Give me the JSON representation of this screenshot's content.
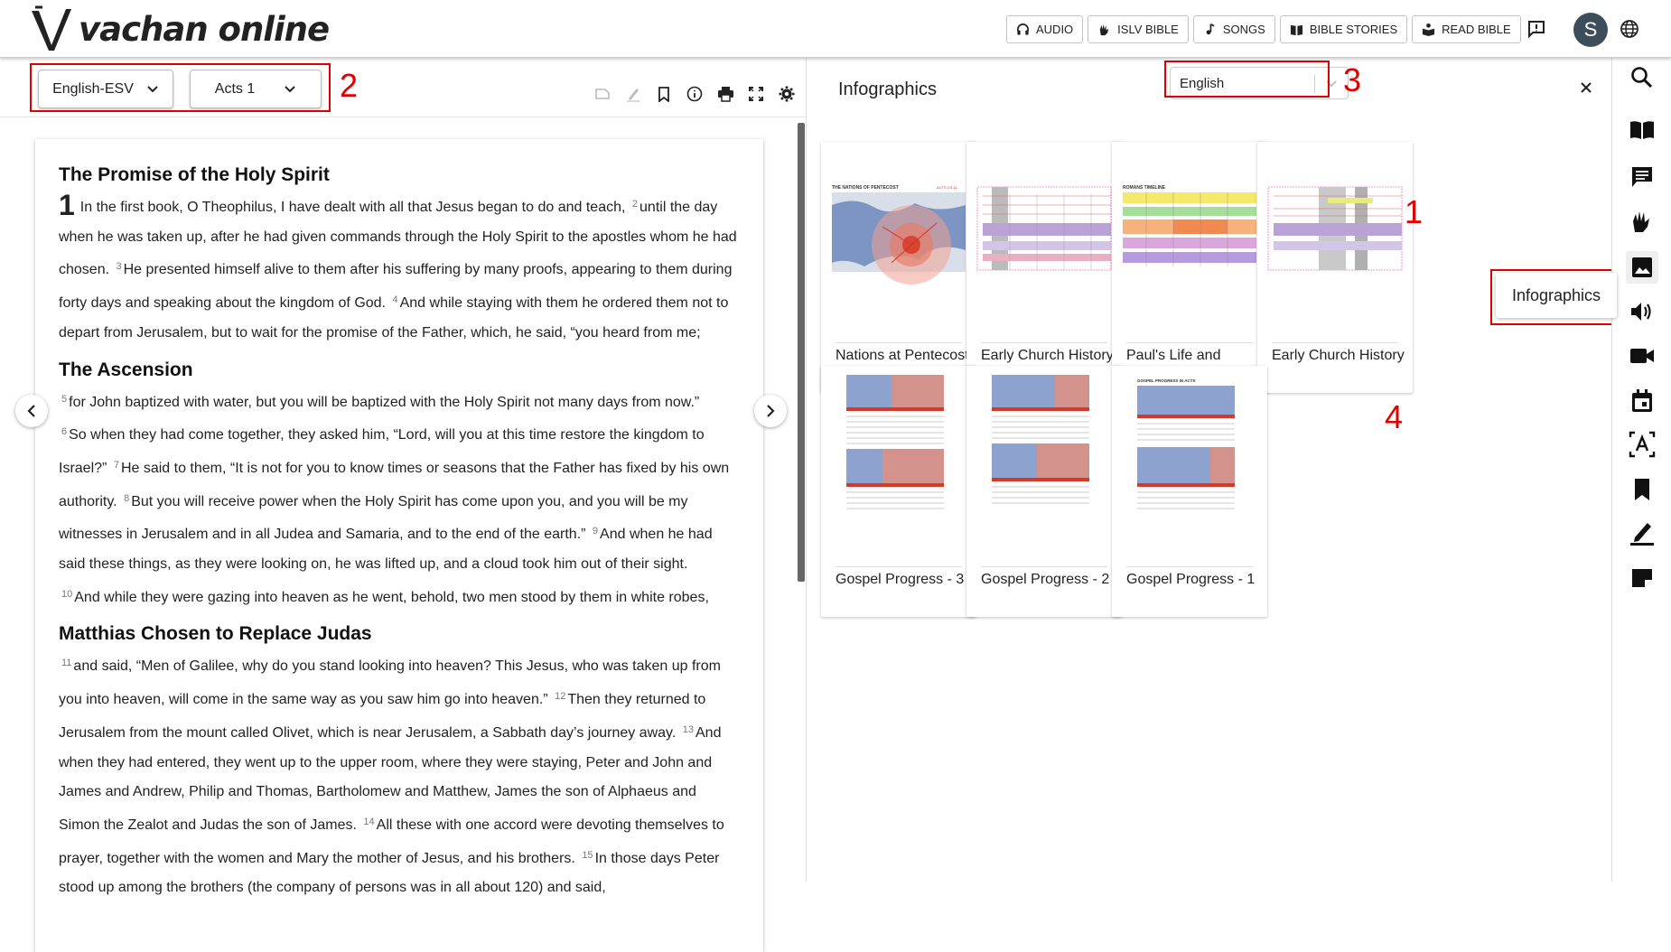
{
  "app": {
    "logo_text": "vachan online"
  },
  "header": {
    "nav": [
      {
        "label": "AUDIO",
        "icon": "headphones-icon"
      },
      {
        "label": "ISLV BIBLE",
        "icon": "sign-language-icon"
      },
      {
        "label": "SONGS",
        "icon": "music-note-icon"
      },
      {
        "label": "BIBLE STORIES",
        "icon": "book-open-icon"
      },
      {
        "label": "READ BIBLE",
        "icon": "book-reader-icon"
      }
    ],
    "avatar_initial": "S"
  },
  "left_toolbar": {
    "version": "English-ESV",
    "book_chapter": "Acts 1"
  },
  "annotations": [
    "1",
    "2",
    "3",
    "4"
  ],
  "reader": {
    "sections": [
      {
        "heading": "The Promise of the Holy Spirit",
        "chapter": "1",
        "verses": [
          {
            "n": "",
            "text": "In the first book, O Theophilus, I have dealt with all that Jesus began to do and teach,"
          },
          {
            "n": "2",
            "text": "until the day when he was taken up, after he had given commands through the Holy Spirit to the apostles whom he had chosen."
          },
          {
            "n": "3",
            "text": "He presented himself alive to them after his suffering by many proofs, appearing to them during forty days and speaking about the kingdom of God."
          },
          {
            "n": "4",
            "text": "And while staying with them he ordered them not to depart from Jerusalem, but to wait for the promise of the Father, which, he said, “you heard from me;"
          }
        ]
      },
      {
        "heading": "The Ascension",
        "verses": [
          {
            "n": "5",
            "text": "for John baptized with water, but you will be baptized with the Holy Spirit not many days from now.”"
          },
          {
            "n": "6",
            "text": "So when they had come together, they asked him, “Lord, will you at this time restore the kingdom to Israel?”"
          },
          {
            "n": "7",
            "text": "He said to them, “It is not for you to know times or seasons that the Father has fixed by his own authority."
          },
          {
            "n": "8",
            "text": "But you will receive power when the Holy Spirit has come upon you, and you will be my witnesses in Jerusalem and in all Judea and Samaria, and to the end of the earth.”"
          },
          {
            "n": "9",
            "text": "And when he had said these things, as they were looking on, he was lifted up, and a cloud took him out of their sight."
          },
          {
            "n": "10",
            "text": "And while they were gazing into heaven as he went, behold, two men stood by them in white robes,"
          }
        ]
      },
      {
        "heading": "Matthias Chosen to Replace Judas",
        "verses": [
          {
            "n": "11",
            "text": "and said, “Men of Galilee, why do you stand looking into heaven? This Jesus, who was taken up from you into heaven, will come in the same way as you saw him go into heaven.”"
          },
          {
            "n": "12",
            "text": "Then they returned to Jerusalem from the mount called Olivet, which is near Jerusalem, a Sabbath day’s journey away."
          },
          {
            "n": "13",
            "text": "And when they had entered, they went up to the upper room, where they were staying, Peter and John and James and Andrew, Philip and Thomas, Bartholomew and Matthew, James the son of Alphaeus and Simon the Zealot and Judas the son of James."
          },
          {
            "n": "14",
            "text": "All these with one accord were devoting themselves to prayer, together with the women and Mary the mother of Jesus, and his brothers."
          },
          {
            "n": "15",
            "text": "In those days Peter stood up among the brothers (the company of persons was in all about 120) and said,"
          }
        ]
      }
    ]
  },
  "infographics": {
    "title": "Infographics",
    "language": "English",
    "cards": [
      {
        "title": "Nations at Pentecost",
        "thumb": "map"
      },
      {
        "title": "Early Church History",
        "thumb": "timeline"
      },
      {
        "title": "Paul's Life and Mission Timeline",
        "thumb": "timeline-color"
      },
      {
        "title": "Early Church History",
        "thumb": "timeline"
      },
      {
        "title": "Gospel Progress - 3",
        "thumb": "maps-stack"
      },
      {
        "title": "Gospel Progress - 2",
        "thumb": "maps-stack"
      },
      {
        "title": "Gospel Progress - 1",
        "thumb": "maps-stack"
      }
    ],
    "thumb_text": {
      "map_header": "THE NATIONS OF PENTECOST",
      "map_ref": "ACTS 2:5-11",
      "timeline_header": "ROMANS TIMELINE",
      "gospel_header": "GOSPEL PROGRESS IN ACTS"
    }
  },
  "sidebar": {
    "icons": [
      "search-icon",
      "book-icon",
      "comment-icon",
      "sign-language-icon",
      "image-icon",
      "audio-icon",
      "video-icon",
      "calendar-icon",
      "dictionary-icon",
      "bookmark-icon",
      "highlight-icon",
      "notes-icon"
    ],
    "tooltip": "Infographics"
  },
  "colors": {
    "annotation": "#e00000",
    "accent": "#222222"
  }
}
